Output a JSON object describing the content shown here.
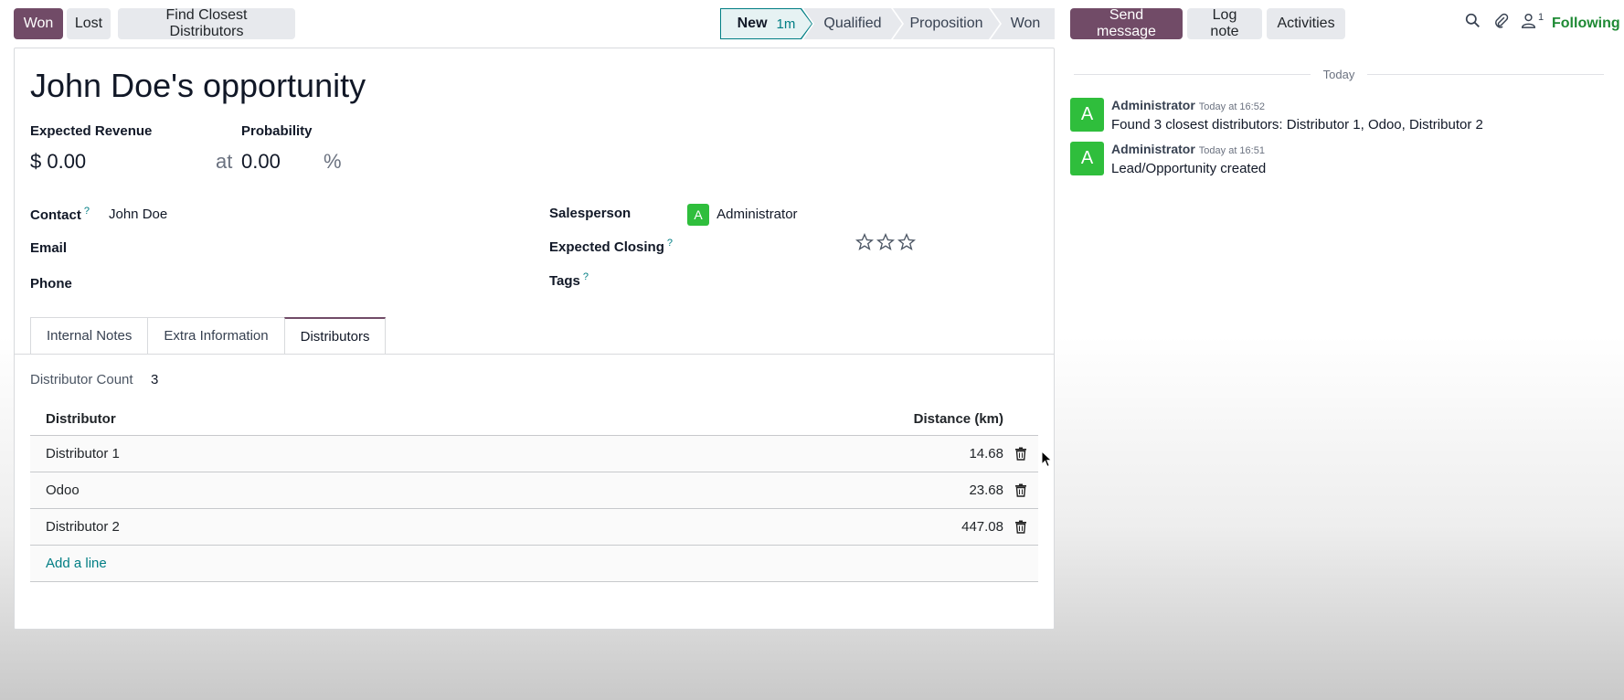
{
  "header": {
    "won_label": "Won",
    "lost_label": "Lost",
    "find_label": "Find Closest Distributors",
    "stages": [
      {
        "label": "New",
        "duration": "1m"
      },
      {
        "label": "Qualified"
      },
      {
        "label": "Proposition"
      },
      {
        "label": "Won"
      }
    ]
  },
  "form": {
    "title": "John Doe's opportunity",
    "expected_revenue_label": "Expected Revenue",
    "expected_revenue": "$ 0.00",
    "at_label": "at",
    "probability_label": "Probability",
    "probability": "0.00",
    "percent": "%",
    "contact_label": "Contact",
    "contact": "John Doe",
    "email_label": "Email",
    "phone_label": "Phone",
    "help_mark": "?",
    "salesperson_label": "Salesperson",
    "salesperson": "Administrator",
    "salesperson_initial": "A",
    "expected_closing_label": "Expected Closing",
    "tags_label": "Tags",
    "tabs": [
      "Internal Notes",
      "Extra Information",
      "Distributors"
    ],
    "distributor_count_label": "Distributor Count",
    "distributor_count": "3",
    "table": {
      "col_distributor": "Distributor",
      "col_distance": "Distance (km)",
      "rows": [
        {
          "name": "Distributor 1",
          "distance": "14.68"
        },
        {
          "name": "Odoo",
          "distance": "23.68"
        },
        {
          "name": "Distributor 2",
          "distance": "447.08"
        }
      ],
      "add_line": "Add a line"
    }
  },
  "chatter": {
    "send_message": "Send message",
    "log_note": "Log note",
    "activities": "Activities",
    "followers_count": "1",
    "following": "Following",
    "today": "Today",
    "messages": [
      {
        "initial": "A",
        "author": "Administrator",
        "time": "Today at 16:52",
        "body": "Found 3 closest distributors: Distributor 1, Odoo, Distributor 2"
      },
      {
        "initial": "A",
        "author": "Administrator",
        "time": "Today at 16:51",
        "body": "Lead/Opportunity created"
      }
    ]
  },
  "colors": {
    "primary": "#714b67",
    "accent": "#017e84",
    "avatar": "#2fbe3c",
    "following": "#1e8a34"
  }
}
